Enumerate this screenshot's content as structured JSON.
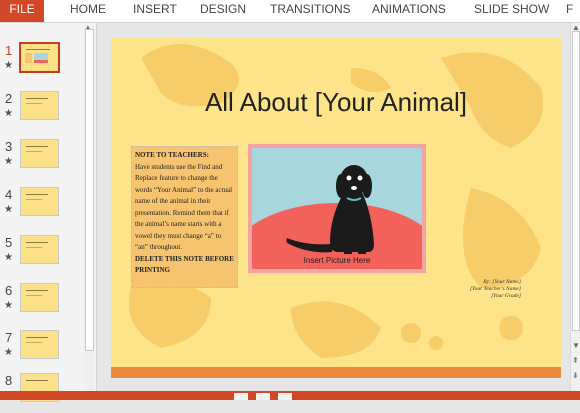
{
  "ribbon": {
    "tabs": [
      "FILE",
      "HOME",
      "INSERT",
      "DESIGN",
      "TRANSITIONS",
      "ANIMATIONS",
      "SLIDE SHOW",
      "F"
    ]
  },
  "thumbnails": {
    "items": [
      {
        "number": "1",
        "active": true
      },
      {
        "number": "2",
        "active": false
      },
      {
        "number": "3",
        "active": false
      },
      {
        "number": "4",
        "active": false
      },
      {
        "number": "5",
        "active": false
      },
      {
        "number": "6",
        "active": false
      },
      {
        "number": "7",
        "active": false
      },
      {
        "number": "8",
        "active": false
      }
    ],
    "star": "★"
  },
  "slide": {
    "title": "All About [Your Animal]",
    "note": {
      "heading": "NOTE TO TEACHERS:",
      "body": "Have students use the Find and Replace feature to change the words “Your Animal” to the actual name of the animal in their presentation. Remind them that if the animal’s name starts with a vowel they must change “a” to “an” throughout.",
      "footer": "DELETE THIS NOTE BEFORE PRINTING"
    },
    "picture_caption": "Insert Picture Here",
    "byline": {
      "line1": "By: [Your Name]",
      "line2": "[Your Teacher’s Name]",
      "line3": "[Your Grade]"
    }
  },
  "colors": {
    "accent": "#d24726",
    "slide_bg": "#fde38a",
    "picture_sky": "#a8d6df",
    "picture_ground": "#f2615a"
  }
}
